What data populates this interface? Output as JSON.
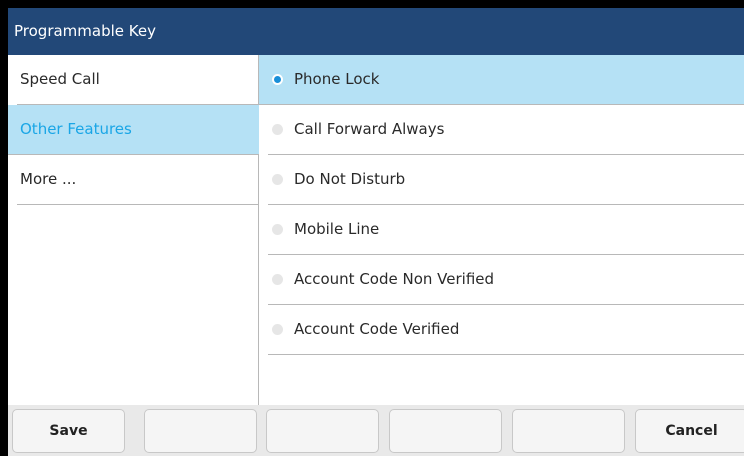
{
  "title": "Programmable Key",
  "sidebar": {
    "items": [
      {
        "label": "Speed Call",
        "selected": false
      },
      {
        "label": "Other Features",
        "selected": true
      },
      {
        "label": "More ...",
        "selected": false
      }
    ]
  },
  "options": {
    "items": [
      {
        "label": "Phone Lock",
        "selected": true
      },
      {
        "label": "Call Forward Always",
        "selected": false
      },
      {
        "label": "Do Not Disturb",
        "selected": false
      },
      {
        "label": "Mobile Line",
        "selected": false
      },
      {
        "label": "Account Code Non Verified",
        "selected": false
      },
      {
        "label": "Account Code Verified",
        "selected": false
      }
    ]
  },
  "softkeys": {
    "keys": [
      {
        "label": "Save"
      },
      {
        "label": ""
      },
      {
        "label": ""
      },
      {
        "label": ""
      },
      {
        "label": ""
      },
      {
        "label": "Cancel"
      }
    ]
  },
  "colors": {
    "titlebar": "#224878",
    "selection_bg": "#b5e1f5",
    "selection_text": "#1aa6e6",
    "radio_selected": "#1a8fd8"
  }
}
